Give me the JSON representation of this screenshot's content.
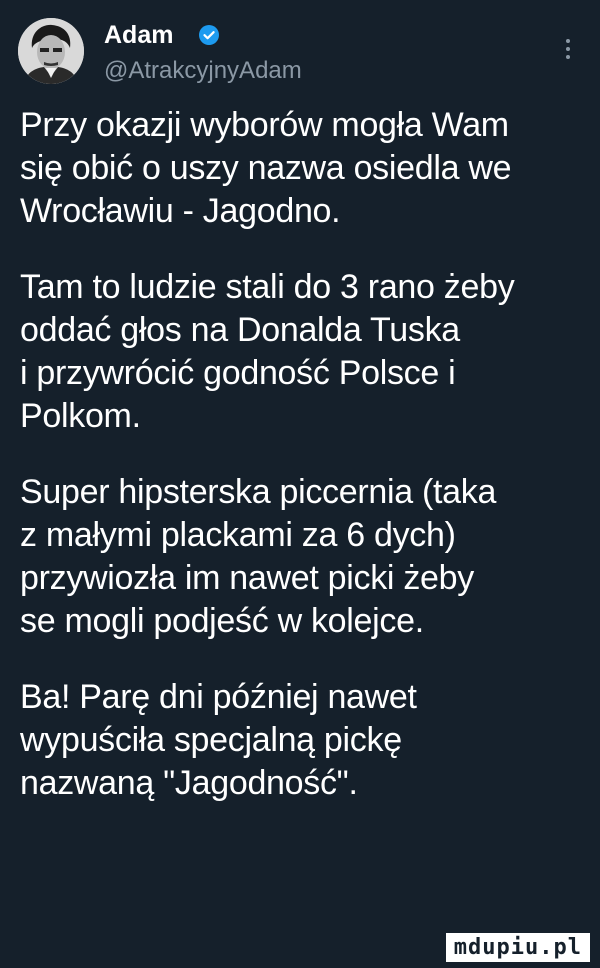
{
  "author": {
    "display_name": "Adam",
    "handle": "@AtrakcyjnyAdam",
    "verified": true,
    "avatar_icon": "profile-photo",
    "badge_color": "#1d9bf0"
  },
  "tweet": {
    "paragraphs": [
      {
        "lines": [
          "Przy okazji wyborów mogła Wam",
          "się obić o uszy nazwa osiedla we",
          "Wrocławiu - Jagodno."
        ]
      },
      {
        "lines": [
          "Tam to ludzie stali do 3 rano żeby",
          "oddać głos na Donalda Tuska",
          "i przywrócić godność Polsce i",
          "Polkom."
        ]
      },
      {
        "lines": [
          "Super hipsterska piccernia (taka",
          "z małymi plackami za 6 dych)",
          "przywiozła im nawet picki żeby",
          "se mogli podjeść w kolejce."
        ]
      },
      {
        "lines": [
          "Ba! Parę dni później nawet",
          "wypuściła specjalną pickę",
          "nazwaną \"Jagodność\"."
        ]
      }
    ]
  },
  "watermark": "mdupiu.pl",
  "colors": {
    "background": "#15202b",
    "text": "#ffffff",
    "secondary_text": "#8b98a5"
  }
}
